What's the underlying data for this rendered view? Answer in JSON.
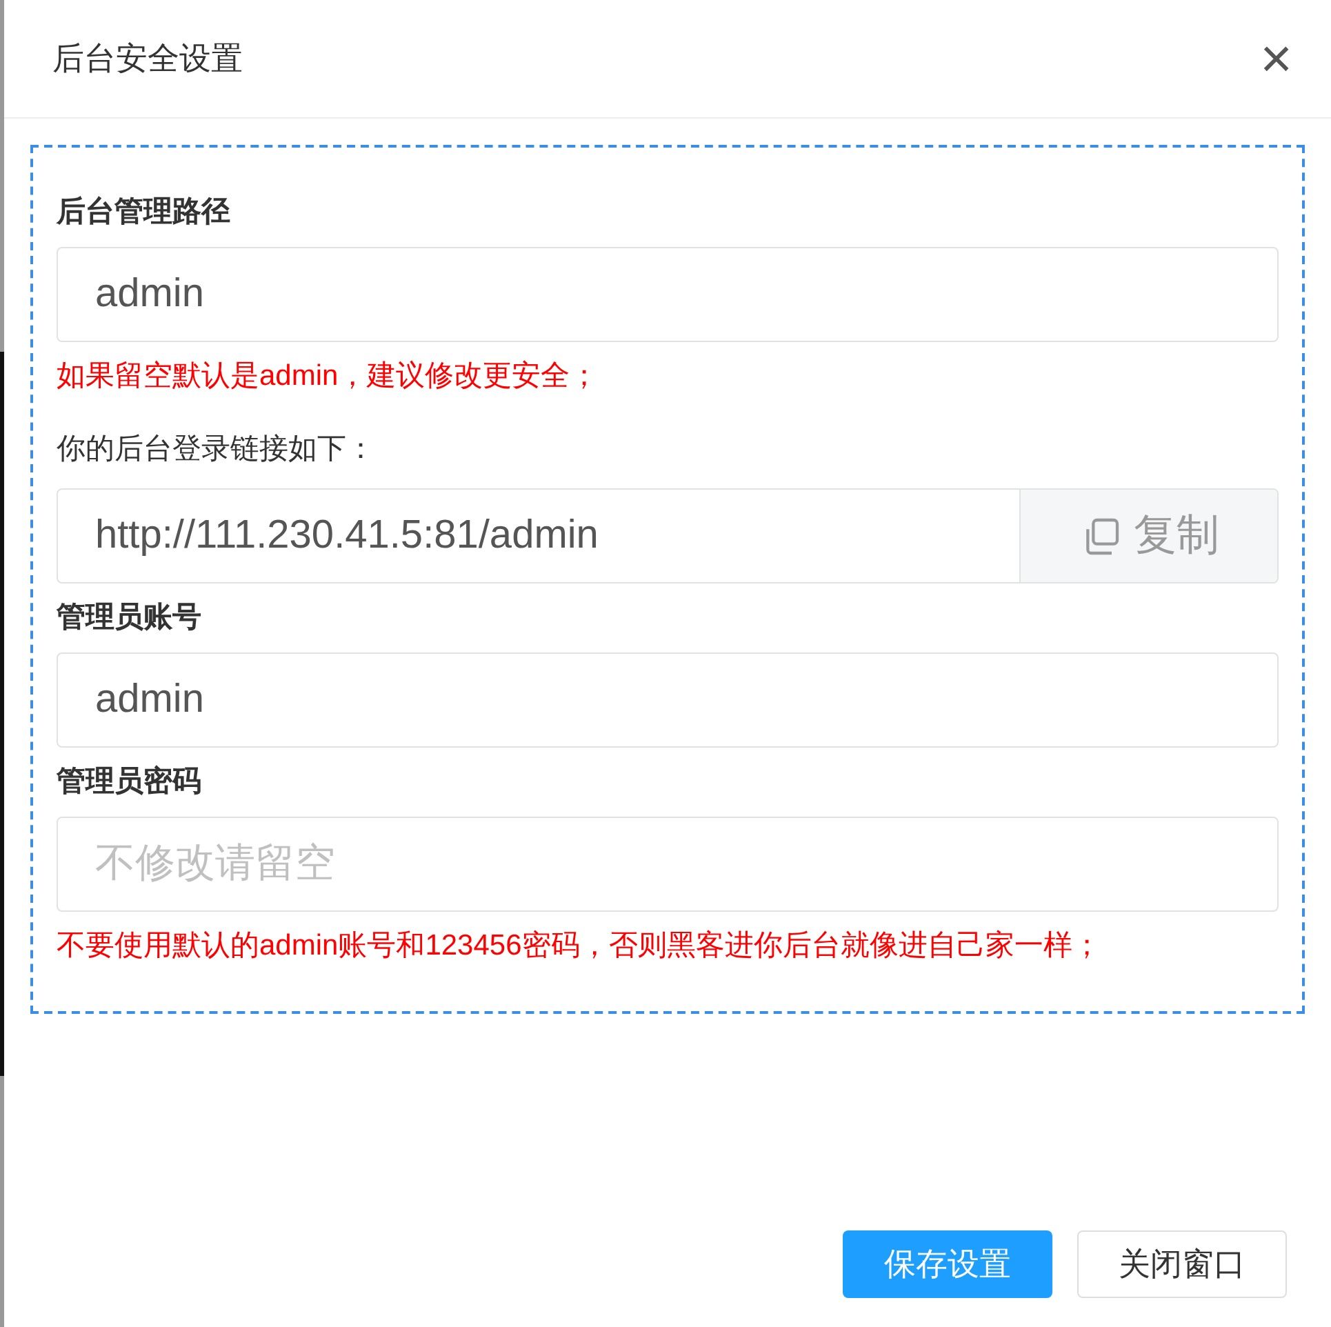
{
  "dialog": {
    "title": "后台安全设置",
    "close": "×"
  },
  "form": [
    {
      "kind": "label",
      "text": "后台管理路径"
    },
    {
      "kind": "input",
      "value": "admin"
    },
    {
      "kind": "hint",
      "text": "如果留空默认是admin，建议修改更安全；"
    },
    {
      "kind": "note",
      "text": "你的后台登录链接如下："
    },
    {
      "kind": "copy",
      "value": "http://111.230.41.5:81/admin",
      "button": "复制"
    },
    {
      "kind": "label",
      "text": "管理员账号"
    },
    {
      "kind": "input",
      "value": "admin"
    },
    {
      "kind": "label",
      "text": "管理员密码"
    },
    {
      "kind": "input",
      "placeholder": "不修改请留空"
    },
    {
      "kind": "hint",
      "text": "不要使用默认的admin账号和123456密码，否则黑客进你后台就像进自己家一样；"
    }
  ],
  "buttons": [
    {
      "label": "保存设置",
      "primary": true
    },
    {
      "label": "关闭窗口",
      "primary": false
    }
  ]
}
